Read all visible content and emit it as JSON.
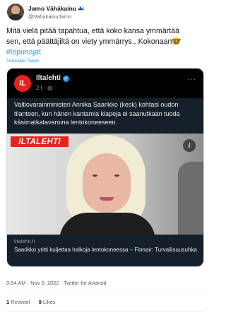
{
  "author": {
    "display_name": "Jarno Vähäkainu",
    "handle": "@VahakainuJarno",
    "flag_icon": "finland-flag"
  },
  "tweet": {
    "text_line1": "Mitä vielä pitää tapahtua, että koko kansa ymmärtää",
    "text_line2": "sen, että päättäjiltä on viety ymmärrys.. Kokonaan",
    "emoji": "🤓",
    "hashtag": "#lopunajat",
    "translate_label": "Translate Tweet"
  },
  "card": {
    "source_name": "Iltalehti",
    "source_logo_text": "IL",
    "meta": "2 t",
    "text": "Valtiovarainministeri Annika Saarikko (kesk) kohtasi oudon tilanteen, kun hänen kantamia klapeja ei saanutkaan tuoda käsimatkatavaroina lentokoneeseen.",
    "photo_watermark": "ILTALEHTI",
    "info_label": "i",
    "domain": "iltalehti.fi",
    "title": "Saarikko yritti kuljettaa halkoja lentokoneessa – Finnair: Turvallisuusuhka"
  },
  "footer": {
    "timestamp": "9:54 AM · Nov 5, 2022 · Twitter for Android",
    "retweets_count": "1",
    "retweets_label": "Retweet",
    "likes_count": "9",
    "likes_label": "Likes"
  },
  "colors": {
    "accent": "#1d9bf0",
    "iltalehti_red": "#e8231f",
    "card_bg": "#15202b"
  }
}
